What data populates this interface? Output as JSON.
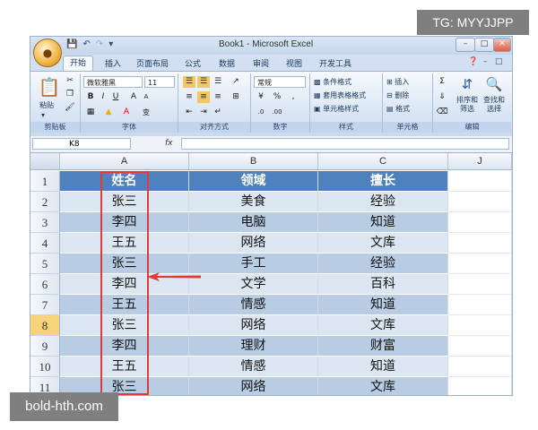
{
  "watermark_top": "TG: MYYJJPP",
  "watermark_bottom": "bold-hth.com",
  "window": {
    "title": "Book1 - Microsoft Excel"
  },
  "tabs": [
    "开始",
    "插入",
    "页面布局",
    "公式",
    "数据",
    "审阅",
    "视图",
    "开发工具"
  ],
  "ribbon": {
    "paste": "粘贴",
    "font_name": "微软雅黑",
    "font_size": "11",
    "number_format": "常规",
    "styles": [
      "条件格式",
      "套用表格格式",
      "单元格样式"
    ],
    "cells": [
      "插入",
      "删除",
      "格式"
    ],
    "editing": [
      "排序和筛选",
      "查找和选择"
    ],
    "group_labels": [
      "剪贴板",
      "字体",
      "对齐方式",
      "数字",
      "样式",
      "单元格",
      "编辑"
    ]
  },
  "formula_bar": {
    "name_box": "K8",
    "fx": "fx",
    "value": ""
  },
  "sheet": {
    "columns": [
      "A",
      "B",
      "C",
      "J"
    ],
    "rows": [
      {
        "n": "1",
        "a": "姓名",
        "b": "领域",
        "c": "擅长"
      },
      {
        "n": "2",
        "a": "张三",
        "b": "美食",
        "c": "经验"
      },
      {
        "n": "3",
        "a": "李四",
        "b": "电脑",
        "c": "知道"
      },
      {
        "n": "4",
        "a": "王五",
        "b": "网络",
        "c": "文库"
      },
      {
        "n": "5",
        "a": "张三",
        "b": "手工",
        "c": "经验"
      },
      {
        "n": "6",
        "a": "李四",
        "b": "文学",
        "c": "百科"
      },
      {
        "n": "7",
        "a": "王五",
        "b": "情感",
        "c": "知道"
      },
      {
        "n": "8",
        "a": "张三",
        "b": "网络",
        "c": "文库"
      },
      {
        "n": "9",
        "a": "李四",
        "b": "理财",
        "c": "财富"
      },
      {
        "n": "10",
        "a": "王五",
        "b": "情感",
        "c": "知道"
      },
      {
        "n": "11",
        "a": "张三",
        "b": "网络",
        "c": "文库"
      }
    ],
    "selected_row": "8",
    "colors": {
      "header": "#4f81bd",
      "band_light": "#dce6f1",
      "band_dark": "#b8cce4",
      "highlight": "#e03a3a"
    }
  }
}
